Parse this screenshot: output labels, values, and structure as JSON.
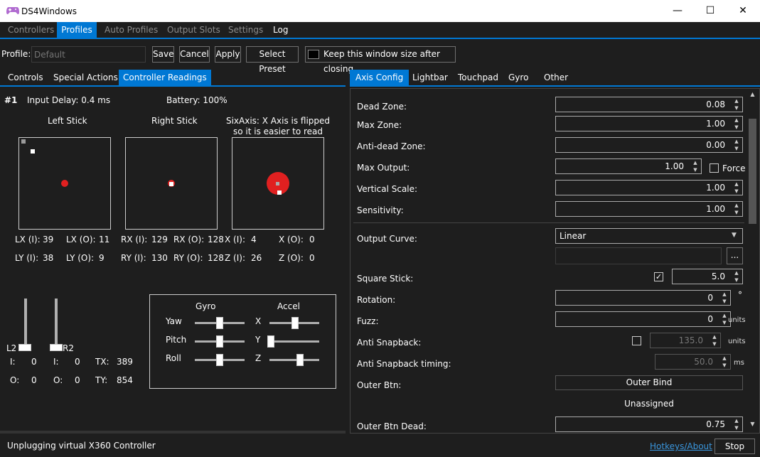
{
  "window": {
    "title": "DS4Windows",
    "minimize": "—",
    "maximize": "☐",
    "close": "✕"
  },
  "main_tabs": [
    "Controllers",
    "Profiles",
    "Auto Profiles",
    "Output Slots",
    "Settings",
    "Log"
  ],
  "profile_bar": {
    "label": "Profile:",
    "placeholder": "Default",
    "save": "Save",
    "cancel": "Cancel",
    "apply": "Apply",
    "select_preset": "Select Preset",
    "keep_size": "Keep this window size after closing"
  },
  "left_tabs": [
    "Controls",
    "Special Actions",
    "Controller Readings"
  ],
  "readings": {
    "slot": "#1",
    "input_delay": "Input Delay: 0.4 ms",
    "battery": "Battery: 100%",
    "left_stick": "Left Stick",
    "right_stick": "Right Stick",
    "sixaxis_note": "SixAxis: X Axis is flipped so it is easier to read",
    "lx_i_l": "LX (I):",
    "lx_i": "39",
    "lx_o_l": "LX (O):",
    "lx_o": "11",
    "ly_i_l": "LY (I):",
    "ly_i": "38",
    "ly_o_l": "LY (O):",
    "ly_o": "9",
    "rx_i_l": "RX (I):",
    "rx_i": "129",
    "rx_o_l": "RX (O):",
    "rx_o": "128",
    "ry_i_l": "RY (I):",
    "ry_i": "130",
    "ry_o_l": "RY (O):",
    "ry_o": "128",
    "x_i_l": "X (I):",
    "x_i": "4",
    "x_o_l": "X (O):",
    "x_o": "0",
    "z_i_l": "Z (I):",
    "z_i": "26",
    "z_o_l": "Z (O):",
    "z_o": "0",
    "l2": "L2",
    "r2": "R2",
    "i_label": "I:",
    "o_label": "O:",
    "l2_i": "0",
    "l2_o": "0",
    "r2_i": "0",
    "r2_o": "0",
    "tx_l": "TX:",
    "tx": "389",
    "ty_l": "TY:",
    "ty": "854",
    "gyro": "Gyro",
    "accel": "Accel",
    "yaw": "Yaw",
    "pitch": "Pitch",
    "roll": "Roll",
    "ax": "X",
    "ay": "Y",
    "az": "Z"
  },
  "right_tabs": [
    "Axis Config",
    "Lightbar",
    "Touchpad",
    "Gyro",
    "Other"
  ],
  "axis": {
    "dead_zone": {
      "label": "Dead Zone:",
      "value": "0.08"
    },
    "max_zone": {
      "label": "Max Zone:",
      "value": "1.00"
    },
    "anti_dead": {
      "label": "Anti-dead Zone:",
      "value": "0.00"
    },
    "max_output": {
      "label": "Max Output:",
      "value": "1.00",
      "force": "Force"
    },
    "vertical_scale": {
      "label": "Vertical Scale:",
      "value": "1.00"
    },
    "sensitivity": {
      "label": "Sensitivity:",
      "value": "1.00"
    },
    "output_curve": {
      "label": "Output Curve:",
      "value": "Linear",
      "browse": "..."
    },
    "square_stick": {
      "label": "Square Stick:",
      "value": "5.0",
      "checked": true
    },
    "rotation": {
      "label": "Rotation:",
      "value": "0",
      "unit": "°"
    },
    "fuzz": {
      "label": "Fuzz:",
      "value": "0",
      "unit": "units"
    },
    "anti_snapback": {
      "label": "Anti Snapback:",
      "value": "135.0",
      "unit": "units"
    },
    "anti_snapback_timing": {
      "label": "Anti Snapback timing:",
      "value": "50.0",
      "unit": "ms"
    },
    "outer_btn": {
      "label": "Outer Btn:",
      "bind": "Outer Bind",
      "assigned": "Unassigned"
    },
    "outer_btn_dead": {
      "label": "Outer Btn Dead:",
      "value": "0.75"
    }
  },
  "status": {
    "message": "Unplugging virtual X360 Controller",
    "hotkeys": "Hotkeys/About",
    "stop": "Stop"
  },
  "colors": {
    "accent": "#0078d4",
    "stick_dot": "#e02020"
  }
}
